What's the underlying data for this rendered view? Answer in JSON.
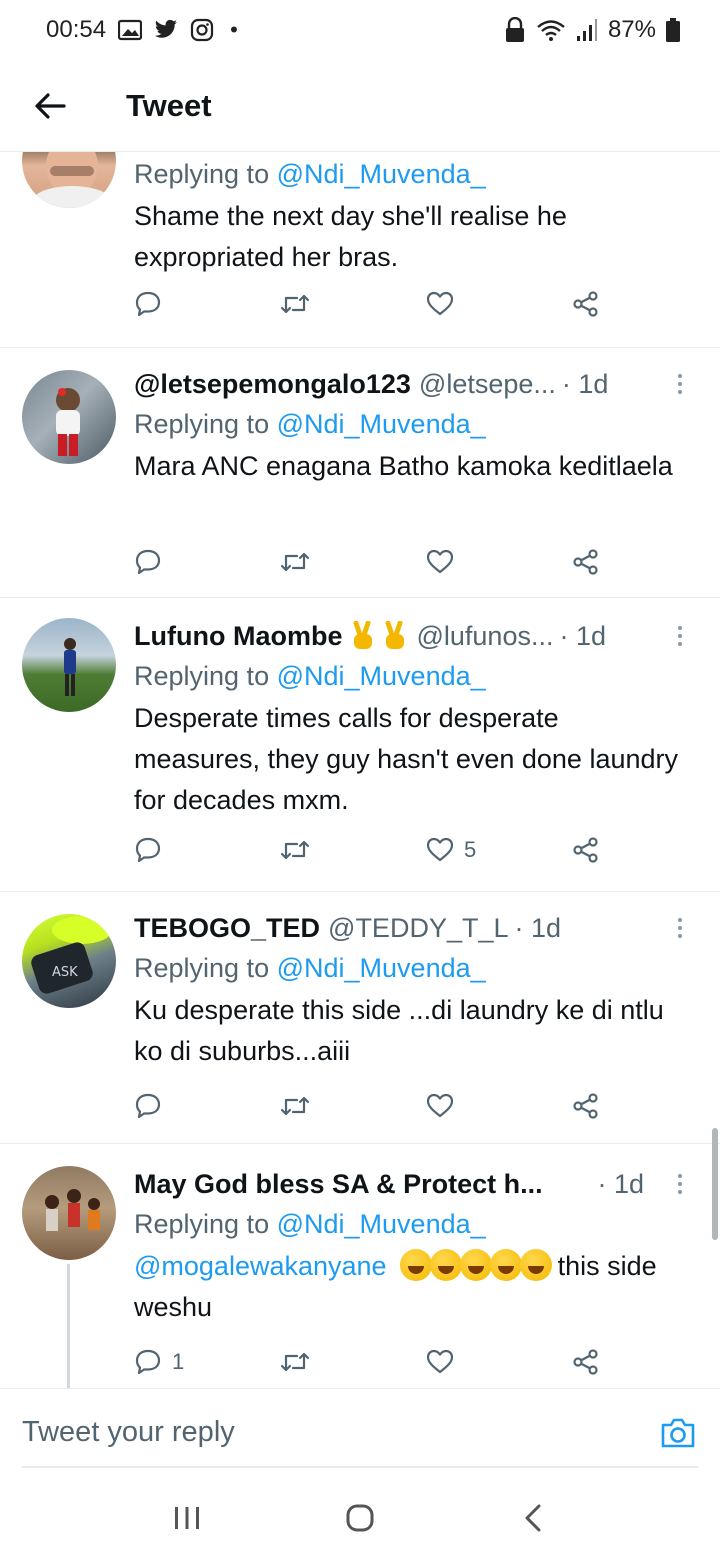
{
  "status_bar": {
    "time": "00:54",
    "battery": "87%",
    "dot": "•"
  },
  "header": {
    "title": "Tweet"
  },
  "colors": {
    "accent": "#1d9bf0",
    "text": "#0f1419",
    "muted": "#536471"
  },
  "tweets": [
    {
      "replying_prefix": "Replying to",
      "replying_to": "@Ndi_Muvenda_",
      "text": "Shame the next day she'll realise he expropriated her bras.",
      "reply_count": "",
      "like_count": ""
    },
    {
      "name": "@letsepemongalo123",
      "handle": "@letsepe...",
      "time": "· 1d",
      "replying_prefix": "Replying to",
      "replying_to": "@Ndi_Muvenda_",
      "text": "Mara ANC enagana Batho kamoka keditlaela",
      "reply_count": "",
      "like_count": ""
    },
    {
      "name": "Lufuno Maombe",
      "handle": "@lufunos...",
      "time": "· 1d",
      "replying_prefix": "Replying to",
      "replying_to": "@Ndi_Muvenda_",
      "text": "Desperate times calls for desperate measures, they guy hasn't even done laundry for decades mxm.",
      "reply_count": "",
      "like_count": "5"
    },
    {
      "name": "TEBOGO_TED",
      "handle": "@TEDDY_T_L",
      "time": "· 1d",
      "replying_prefix": "Replying to",
      "replying_to": "@Ndi_Muvenda_",
      "text": "Ku desperate this side ...di laundry ke di ntlu ko di suburbs...aiii",
      "reply_count": "",
      "like_count": ""
    },
    {
      "name": "May God bless SA & Protect h...",
      "handle": "",
      "time": "· 1d",
      "replying_prefix": "Replying to",
      "replying_to": "@Ndi_Muvenda_",
      "text_mention": "@mogalewakanyane",
      "text_after": "this side weshu",
      "reply_count": "1",
      "like_count": ""
    }
  ],
  "reply_box": {
    "placeholder": "Tweet your reply"
  },
  "icons": {
    "back": "arrow-left-icon",
    "reply": "speech-bubble-icon",
    "retweet": "retweet-icon",
    "like": "heart-icon",
    "share": "share-icon",
    "camera": "camera-icon"
  }
}
